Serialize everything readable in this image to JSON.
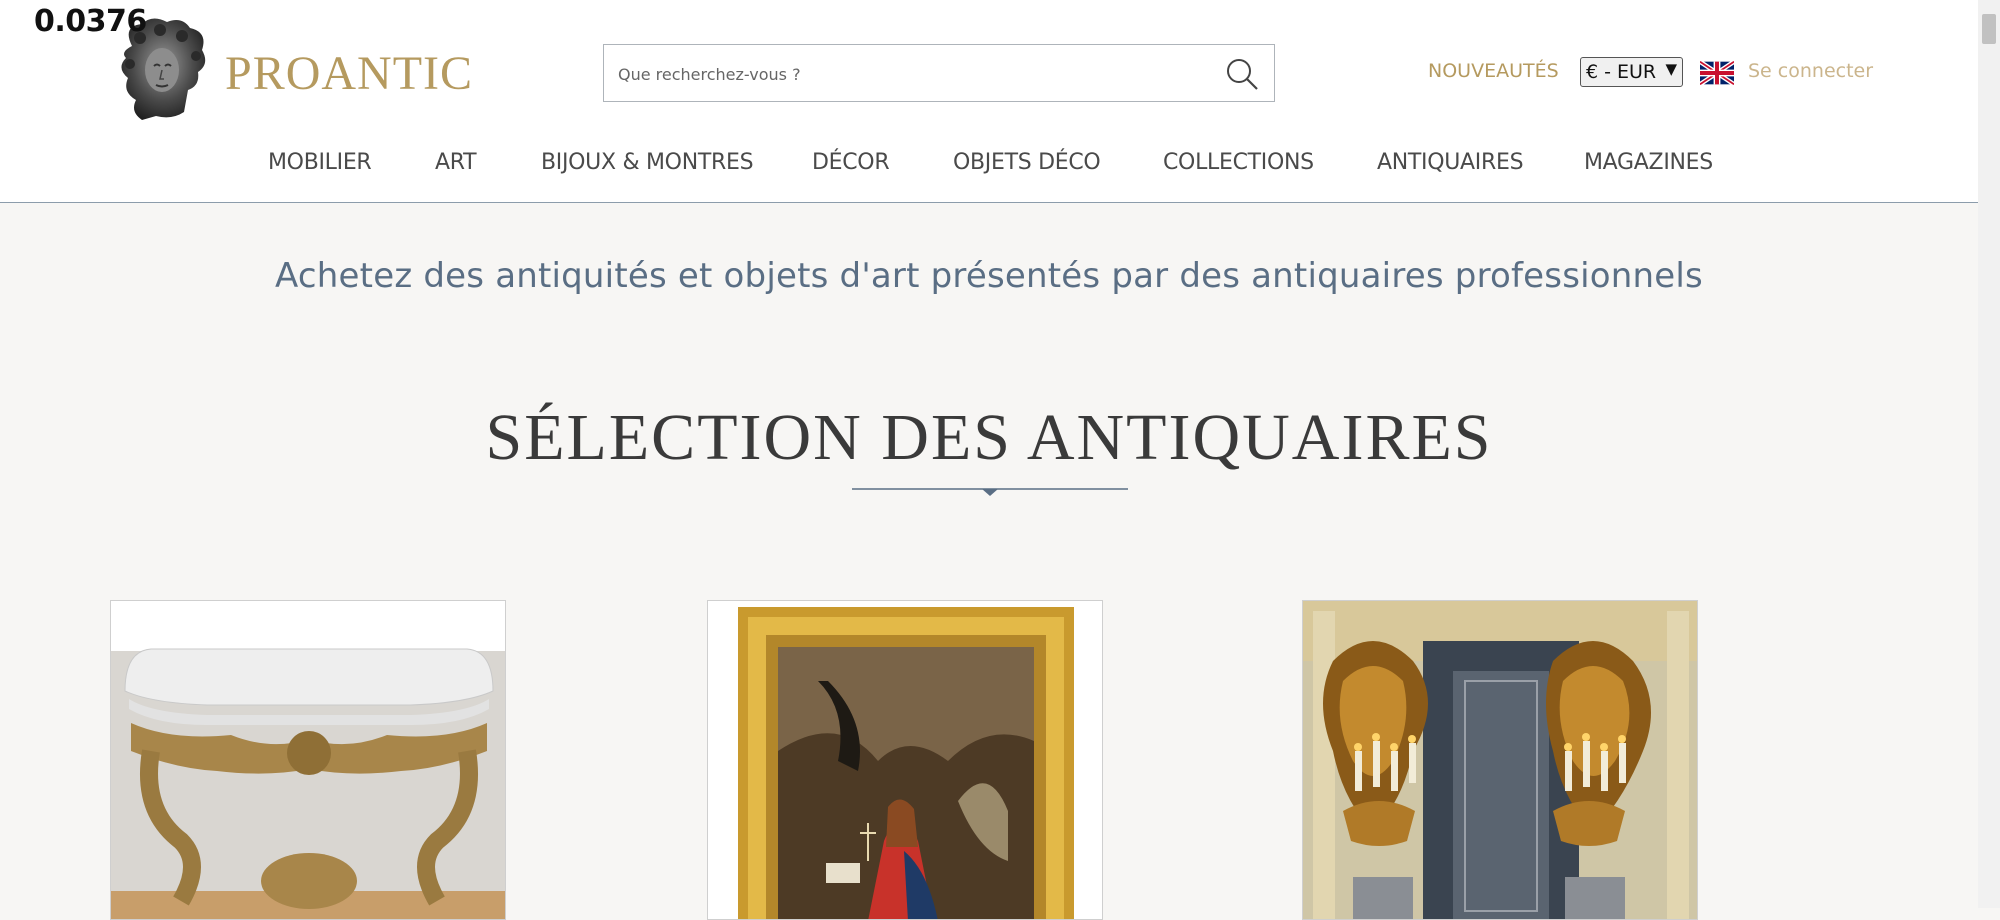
{
  "overlay_value": "0.0376",
  "header": {
    "logo_text": "PROANTIC",
    "search": {
      "placeholder": "Que recherchez-vous ?",
      "value": ""
    },
    "nouveautes_label": "NOUVEAUTÉS",
    "currency_selected": "€ - EUR",
    "language_flag_icon": "uk-flag-icon",
    "login_label": "Se connecter"
  },
  "nav": {
    "items": [
      {
        "label": "MOBILIER"
      },
      {
        "label": "ART"
      },
      {
        "label": "BIJOUX & MONTRES"
      },
      {
        "label": "DÉCOR"
      },
      {
        "label": "OBJETS DÉCO"
      },
      {
        "label": "COLLECTIONS"
      },
      {
        "label": "ANTIQUAIRES"
      },
      {
        "label": "MAGAZINES"
      }
    ]
  },
  "main": {
    "tagline": "Achetez des antiquités et objets d'art présentés par des antiquaires professionnels",
    "section_title": "SÉLECTION DES ANTIQUAIRES"
  },
  "colors": {
    "brand_gold": "#b59a5f",
    "login_gold": "#cbb58c",
    "tagline_blue": "#5a6e84",
    "page_background": "#f7f6f4"
  }
}
